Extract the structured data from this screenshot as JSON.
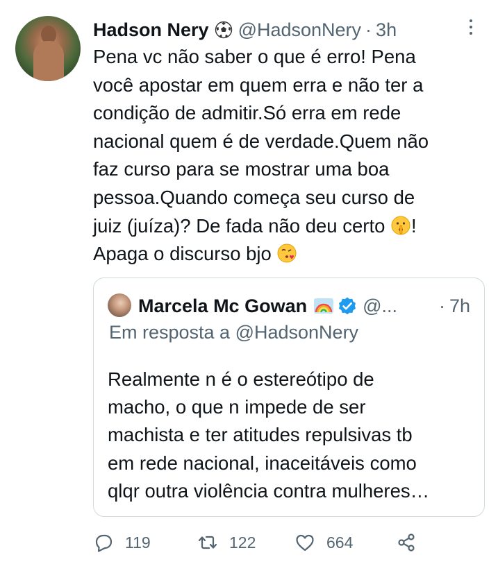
{
  "tweet": {
    "author_name": "Hadson Nery",
    "author_emoji": "soccer-ball-icon",
    "handle": "@HadsonNery",
    "separator": "·",
    "time": "3h",
    "text_lines": [
      "Pena vc não saber o que é erro! Pena",
      "você apostar em quem erra e não ter a",
      "condição de admitir.Só erra em rede",
      "nacional quem é de verdade.Quem não",
      "faz curso para se mostrar uma boa",
      "pessoa.Quando começa seu curso de",
      "juiz (juíza)? De fada não deu certo ",
      "!",
      "Apaga o discurso bjo "
    ],
    "emojis": [
      "shushing-face-icon",
      "kissing-face-icon"
    ]
  },
  "quote": {
    "author_name": "Marcela Mc Gowan",
    "handle": "@...",
    "separator": "·",
    "time": "7h",
    "reply_to": "Em resposta a @HadsonNery",
    "text_lines": [
      "Realmente n é o estereótipo de",
      "macho, o que n impede de ser",
      "machista e ter atitudes repulsivas tb",
      "em rede nacional, inaceitáveis como",
      "qlqr outra violência contra mulheres…"
    ]
  },
  "actions": {
    "replies": "119",
    "retweets": "122",
    "likes": "664"
  },
  "colors": {
    "text": "#0f1419",
    "secondary": "#536471",
    "border": "#cfd9de",
    "verified": "#1d9bf0"
  }
}
